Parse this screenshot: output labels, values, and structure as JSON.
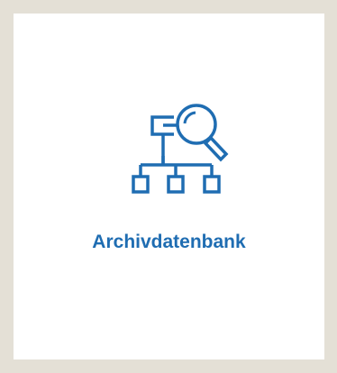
{
  "tile": {
    "label": "Archivdatenbank",
    "icon": "archive-database-search-icon",
    "accent_color": "#1f6db2",
    "background_color": "#ffffff"
  },
  "page": {
    "background_color": "#e4e0d6"
  }
}
